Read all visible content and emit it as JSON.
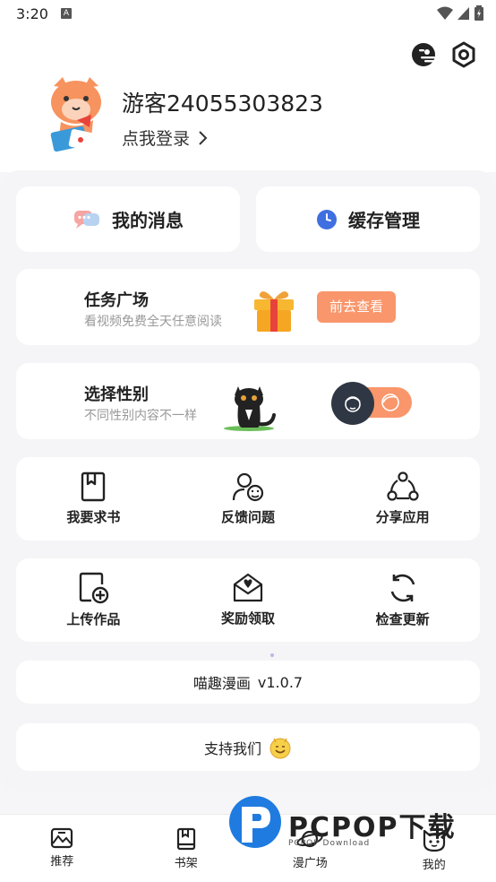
{
  "status_bar": {
    "time": "3:20",
    "notification_icon": "A"
  },
  "header": {
    "user_name": "游客24055303823",
    "login_label": "点我登录"
  },
  "quick_actions": {
    "messages_label": "我的消息",
    "cache_label": "缓存管理"
  },
  "task_square": {
    "title": "任务广场",
    "subtitle": "看视频免费全天任意阅读",
    "button_label": "前去查看"
  },
  "gender": {
    "title": "选择性别",
    "subtitle": "不同性别内容不一样"
  },
  "grid_row_1": [
    {
      "label": "我要求书",
      "icon": "book-request-icon"
    },
    {
      "label": "反馈问题",
      "icon": "feedback-icon"
    },
    {
      "label": "分享应用",
      "icon": "share-icon"
    }
  ],
  "grid_row_2": [
    {
      "label": "上传作品",
      "icon": "upload-icon"
    },
    {
      "label": "奖励领取",
      "icon": "reward-icon"
    },
    {
      "label": "检查更新",
      "icon": "refresh-icon"
    }
  ],
  "version": {
    "app_name": "喵趣漫画",
    "version": "v1.0.7"
  },
  "support_label": "支持我们",
  "tabs": [
    {
      "label": "推荐",
      "icon": "recommend-icon"
    },
    {
      "label": "书架",
      "icon": "bookshelf-icon"
    },
    {
      "label": "漫广场",
      "icon": "planet-icon"
    },
    {
      "label": "我的",
      "icon": "cat-face-icon"
    }
  ],
  "watermark": {
    "brand": "PCPOP下载",
    "sub": "PCPOP Download"
  },
  "colors": {
    "accent": "#f9966b",
    "knob": "#2f3744",
    "panel": "#f5f5f7"
  }
}
